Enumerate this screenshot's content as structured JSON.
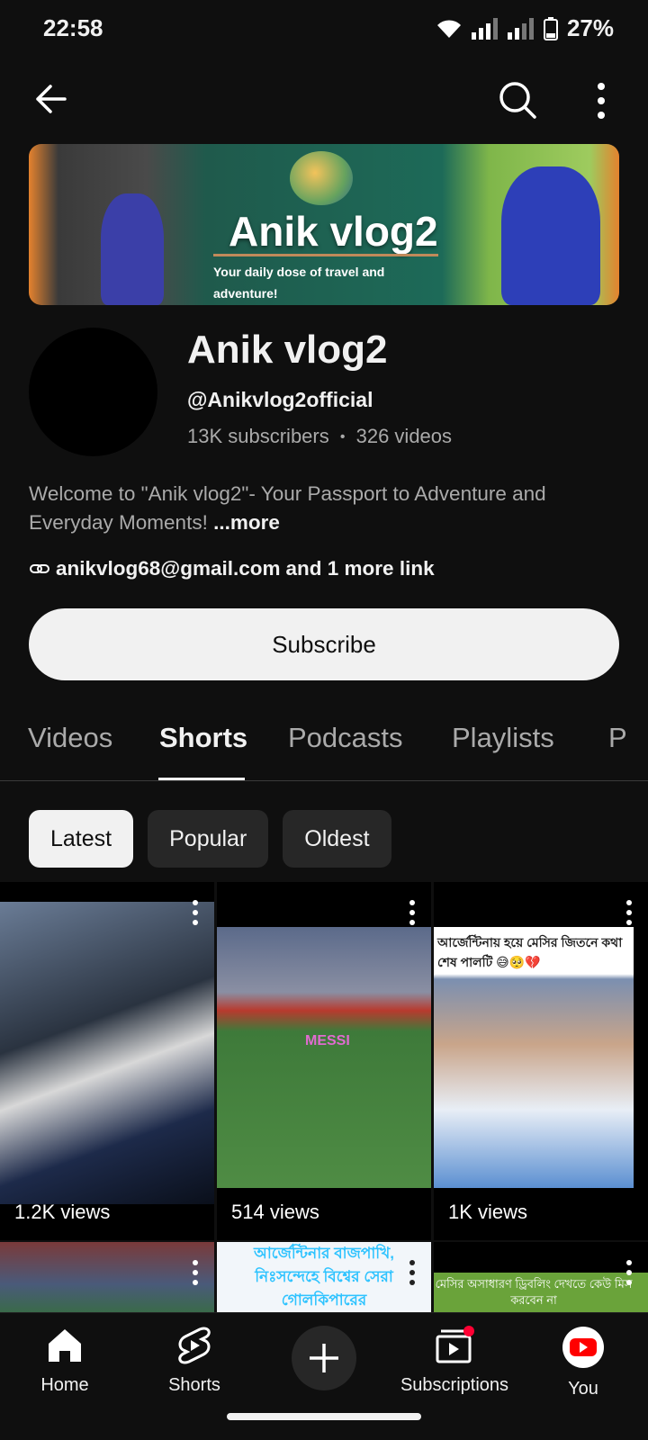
{
  "status": {
    "time": "22:58",
    "battery": "27%"
  },
  "channel": {
    "banner_title": "Anik vlog2",
    "banner_subtitle": "Your daily dose of travel and adventure!",
    "name": "Anik vlog2",
    "handle": "@Anikvlog2official",
    "subscribers": "13K subscribers",
    "separator": "•",
    "videos": "326 videos",
    "description": "Welcome to \"Anik vlog2\"- Your Passport to Adventure and Everyday Moments!",
    "more_label": "...more",
    "link_email": "anikvlog68@gmail.com",
    "link_more": "and 1 more link",
    "subscribe_label": "Subscribe"
  },
  "tabs": [
    {
      "label": "Videos"
    },
    {
      "label": "Shorts",
      "active": true
    },
    {
      "label": "Podcasts"
    },
    {
      "label": "Playlists"
    },
    {
      "label": "P"
    }
  ],
  "chips": [
    {
      "label": "Latest",
      "active": true
    },
    {
      "label": "Popular"
    },
    {
      "label": "Oldest"
    }
  ],
  "shorts": [
    {
      "views": "1.2K views",
      "caption": ""
    },
    {
      "views": "514 views",
      "caption": "MESSI"
    },
    {
      "views": "1K views",
      "caption": "আর্জেন্টিনায় হয়ে মেসির জিতনে কথা শেষ পালটি 😅🥺💔"
    },
    {
      "views": "",
      "caption": ""
    },
    {
      "views": "",
      "caption": "আর্জেন্টিনার বাজপাখি, নিঃসন্দেহে বিশ্বের সেরা গোলকিপারের"
    },
    {
      "views": "",
      "caption": "মেসির অসাধারণ ড্রিবলিং দেখতে কেউ মিস করবেন না"
    }
  ],
  "nav": {
    "home": "Home",
    "shorts": "Shorts",
    "subscriptions": "Subscriptions",
    "you": "You"
  },
  "colors": {
    "background": "#0f0f0f",
    "accent": "#ff0000",
    "chip": "#272727"
  },
  "icons": [
    "back-arrow-icon",
    "search-icon",
    "more-vert-icon",
    "link-icon",
    "home-icon",
    "shorts-icon",
    "plus-icon",
    "subscriptions-icon",
    "you-icon"
  ]
}
